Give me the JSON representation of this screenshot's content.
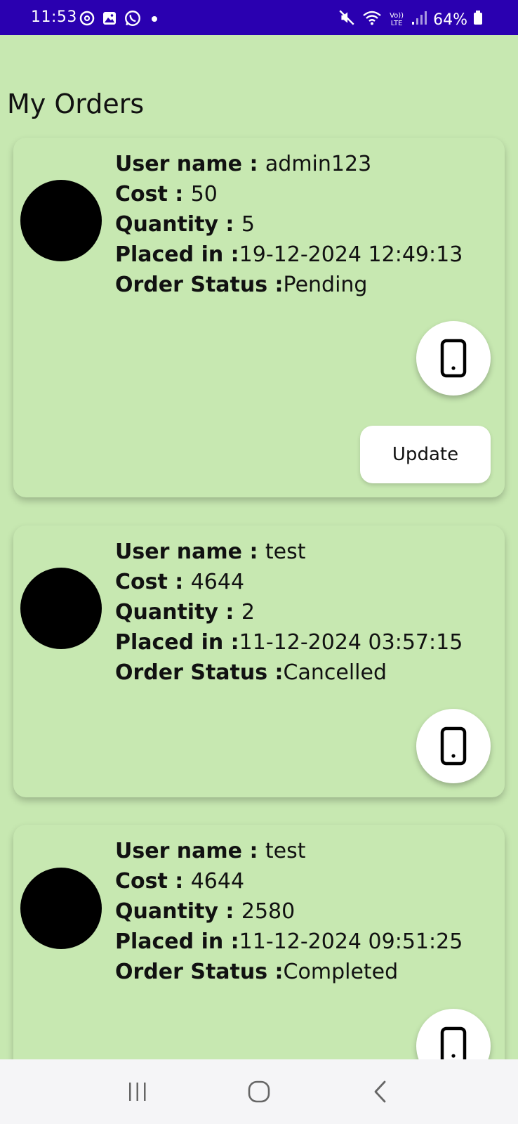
{
  "colors": {
    "status_bar": "#2a00b0",
    "background": "#c7e8b1",
    "card": "#c7e8b1",
    "nav_bar": "#f5f5f7",
    "avatar": "#000000"
  },
  "status_bar": {
    "time": "11:53",
    "battery": "64%",
    "network": "Vo)) LTE",
    "icons": [
      "threads-icon",
      "gallery-icon",
      "whatsapp-icon",
      "dot-icon",
      "mute-icon",
      "wifi-icon",
      "signal-icon",
      "battery-icon"
    ]
  },
  "page": {
    "title": "My Orders"
  },
  "labels": {
    "user_name": "User name : ",
    "cost": "Cost : ",
    "quantity": "Quantity : ",
    "placed_in": "Placed in :",
    "order_status": "Order Status :"
  },
  "orders": [
    {
      "user_name": "admin123",
      "cost": "50",
      "quantity": "5",
      "placed_in": "19-12-2024 12:49:13",
      "status": "Pending",
      "update_label": "Update"
    },
    {
      "user_name": "test",
      "cost": "4644",
      "quantity": "2",
      "placed_in": "11-12-2024 03:57:15",
      "status": "Cancelled"
    },
    {
      "user_name": "test",
      "cost": "4644",
      "quantity": "2580",
      "placed_in": "11-12-2024 09:51:25",
      "status": "Completed"
    }
  ],
  "nav_bar": {
    "icons": [
      "recents-icon",
      "home-icon",
      "back-icon"
    ]
  }
}
